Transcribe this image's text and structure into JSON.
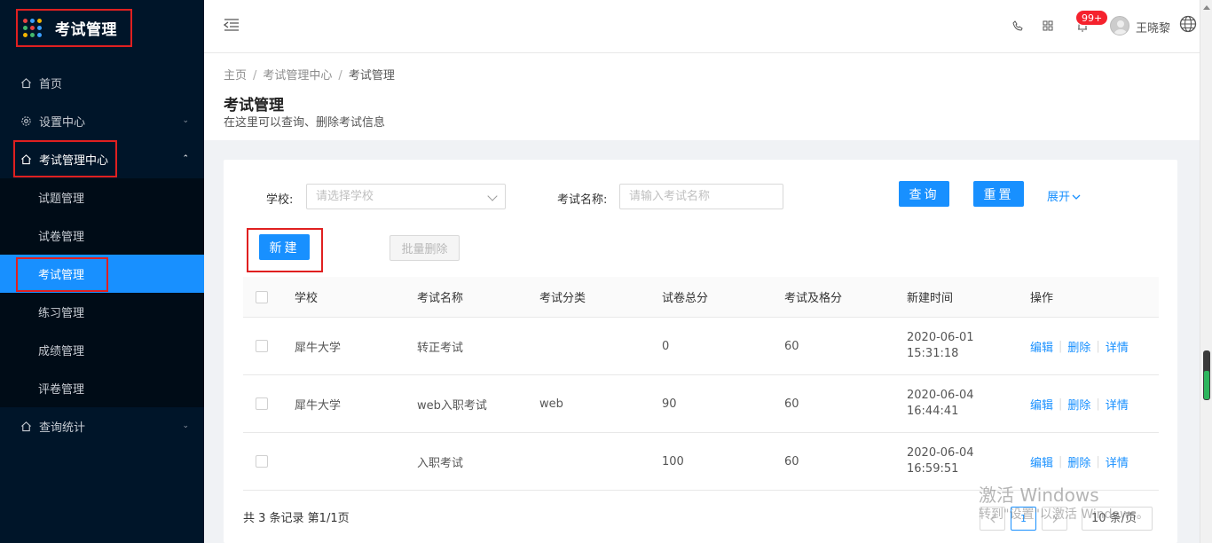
{
  "app": {
    "title": "考试管理",
    "logo_dots": [
      "#e84141",
      "#3aa0ff",
      "#f2b400",
      "#43b86b",
      "#e84141",
      "#3aa0ff",
      "#f2b400",
      "#43b86b",
      "#3aa0ff"
    ]
  },
  "sidebar": {
    "items": [
      {
        "label": "首页",
        "icon": "home-icon"
      },
      {
        "label": "设置中心",
        "icon": "gear-icon"
      },
      {
        "label": "考试管理中心",
        "icon": "home-icon",
        "open": true
      },
      {
        "label": "查询统计",
        "icon": "home-icon"
      }
    ],
    "sub_items": [
      {
        "label": "试题管理"
      },
      {
        "label": "试卷管理"
      },
      {
        "label": "考试管理",
        "active": true
      },
      {
        "label": "练习管理"
      },
      {
        "label": "成绩管理"
      },
      {
        "label": "评卷管理"
      }
    ]
  },
  "header": {
    "notification_count": "99+",
    "username": "王晓黎"
  },
  "breadcrumb": [
    "主页",
    "考试管理中心",
    "考试管理"
  ],
  "page": {
    "title": "考试管理",
    "description": "在这里可以查询、删除考试信息"
  },
  "filters": {
    "school_label": "学校:",
    "school_placeholder": "请选择学校",
    "exam_name_label": "考试名称:",
    "exam_name_placeholder": "请输入考试名称",
    "query_label": "查询",
    "reset_label": "重置",
    "expand_label": "展开"
  },
  "actions": {
    "new_label": "新建",
    "batch_delete_label": "批量删除"
  },
  "table": {
    "headers": [
      "学校",
      "考试名称",
      "考试分类",
      "试卷总分",
      "考试及格分",
      "新建时间",
      "操作"
    ],
    "rows": [
      {
        "school": "犀牛大学",
        "name": "转正考试",
        "category": "",
        "total": "0",
        "pass": "60",
        "date": "2020-06-01",
        "time": "15:31:18"
      },
      {
        "school": "犀牛大学",
        "name": "web入职考试",
        "category": "web",
        "total": "90",
        "pass": "60",
        "date": "2020-06-04",
        "time": "16:44:41"
      },
      {
        "school": "",
        "name": "入职考试",
        "category": "",
        "total": "100",
        "pass": "60",
        "date": "2020-06-04",
        "time": "16:59:51"
      }
    ],
    "ops": {
      "edit": "编辑",
      "delete": "删除",
      "detail": "详情"
    }
  },
  "pagination": {
    "summary": "共 3 条记录 第1/1页",
    "current_page": "1",
    "page_size": "10 条/页"
  },
  "watermark": {
    "line1": "激活 Windows",
    "line2": "转到\"设置\"以激活 Windows。"
  },
  "colors": {
    "sidebar_bg": "#001529",
    "primary": "#1890ff",
    "highlight_box": "#e02020"
  }
}
